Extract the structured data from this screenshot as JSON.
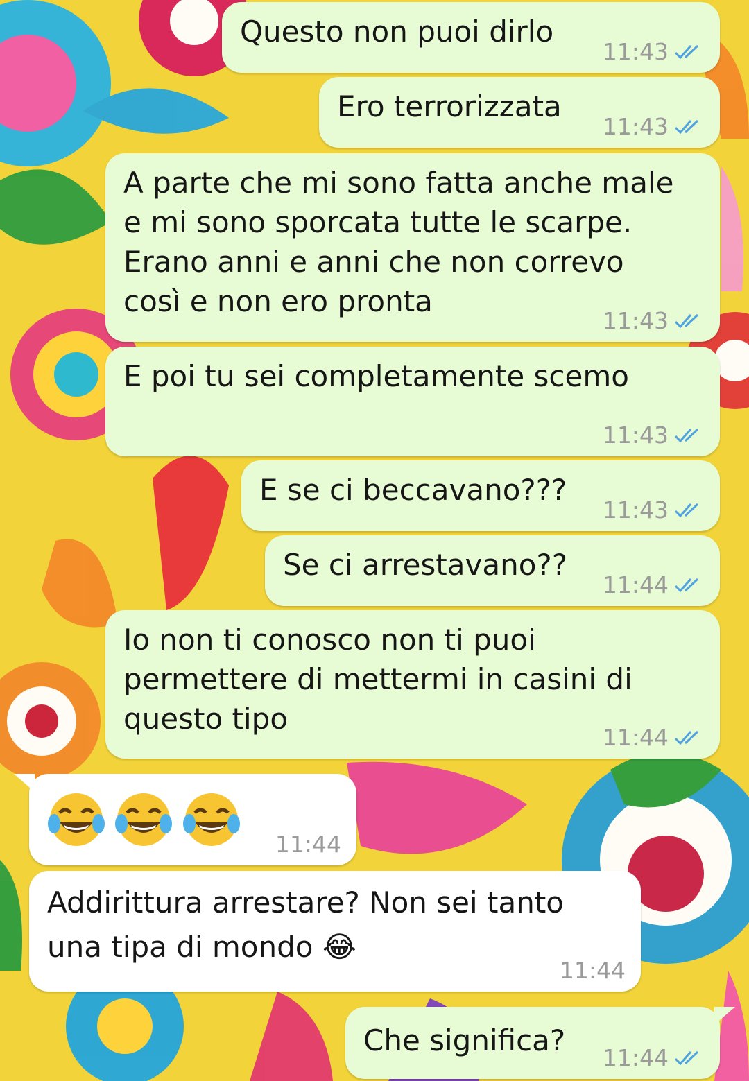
{
  "chat": {
    "messages": [
      {
        "dir": "out",
        "text": "Questo non puoi dirlo",
        "time": "11:43",
        "status_icon": "double-check-read-icon"
      },
      {
        "dir": "out",
        "text": "Ero terrorizzata",
        "time": "11:43",
        "status_icon": "double-check-read-icon"
      },
      {
        "dir": "out",
        "text": "A parte che mi sono fatta anche male\ne mi sono sporcata tutte le scarpe.\nErano anni e anni che non correvo\ncosì e non ero pronta",
        "time": "11:43",
        "status_icon": "double-check-read-icon"
      },
      {
        "dir": "out",
        "text": "E poi tu sei completamente scemo",
        "time": "11:43",
        "status_icon": "double-check-read-icon"
      },
      {
        "dir": "out",
        "text": "E se ci beccavano???",
        "time": "11:43",
        "status_icon": "double-check-read-icon"
      },
      {
        "dir": "out",
        "text": "Se ci arrestavano??",
        "time": "11:44",
        "status_icon": "double-check-read-icon"
      },
      {
        "dir": "out",
        "text": "Io non ti conosco non ti puoi\npermettere di mettermi in casini di\nquesto tipo",
        "time": "11:44",
        "status_icon": "double-check-read-icon"
      },
      {
        "dir": "in",
        "text": "😂😂😂",
        "emoji_icons": [
          "tears-of-joy-emoji",
          "tears-of-joy-emoji",
          "tears-of-joy-emoji"
        ],
        "time": "11:44"
      },
      {
        "dir": "in",
        "text": "Addirittura arrestare? Non sei tanto\nuna tipa di mondo 😂",
        "emoji_icons": [
          "tears-of-joy-emoji"
        ],
        "time": "11:44"
      },
      {
        "dir": "out",
        "text": "Che significa?",
        "time": "11:44",
        "status_icon": "double-check-read-icon"
      }
    ]
  },
  "colors": {
    "outgoing_bubble": "#e7fbd4",
    "incoming_bubble": "#ffffff",
    "read_ticks": "#4fa3e0",
    "time_text": "#9a9a9a"
  }
}
